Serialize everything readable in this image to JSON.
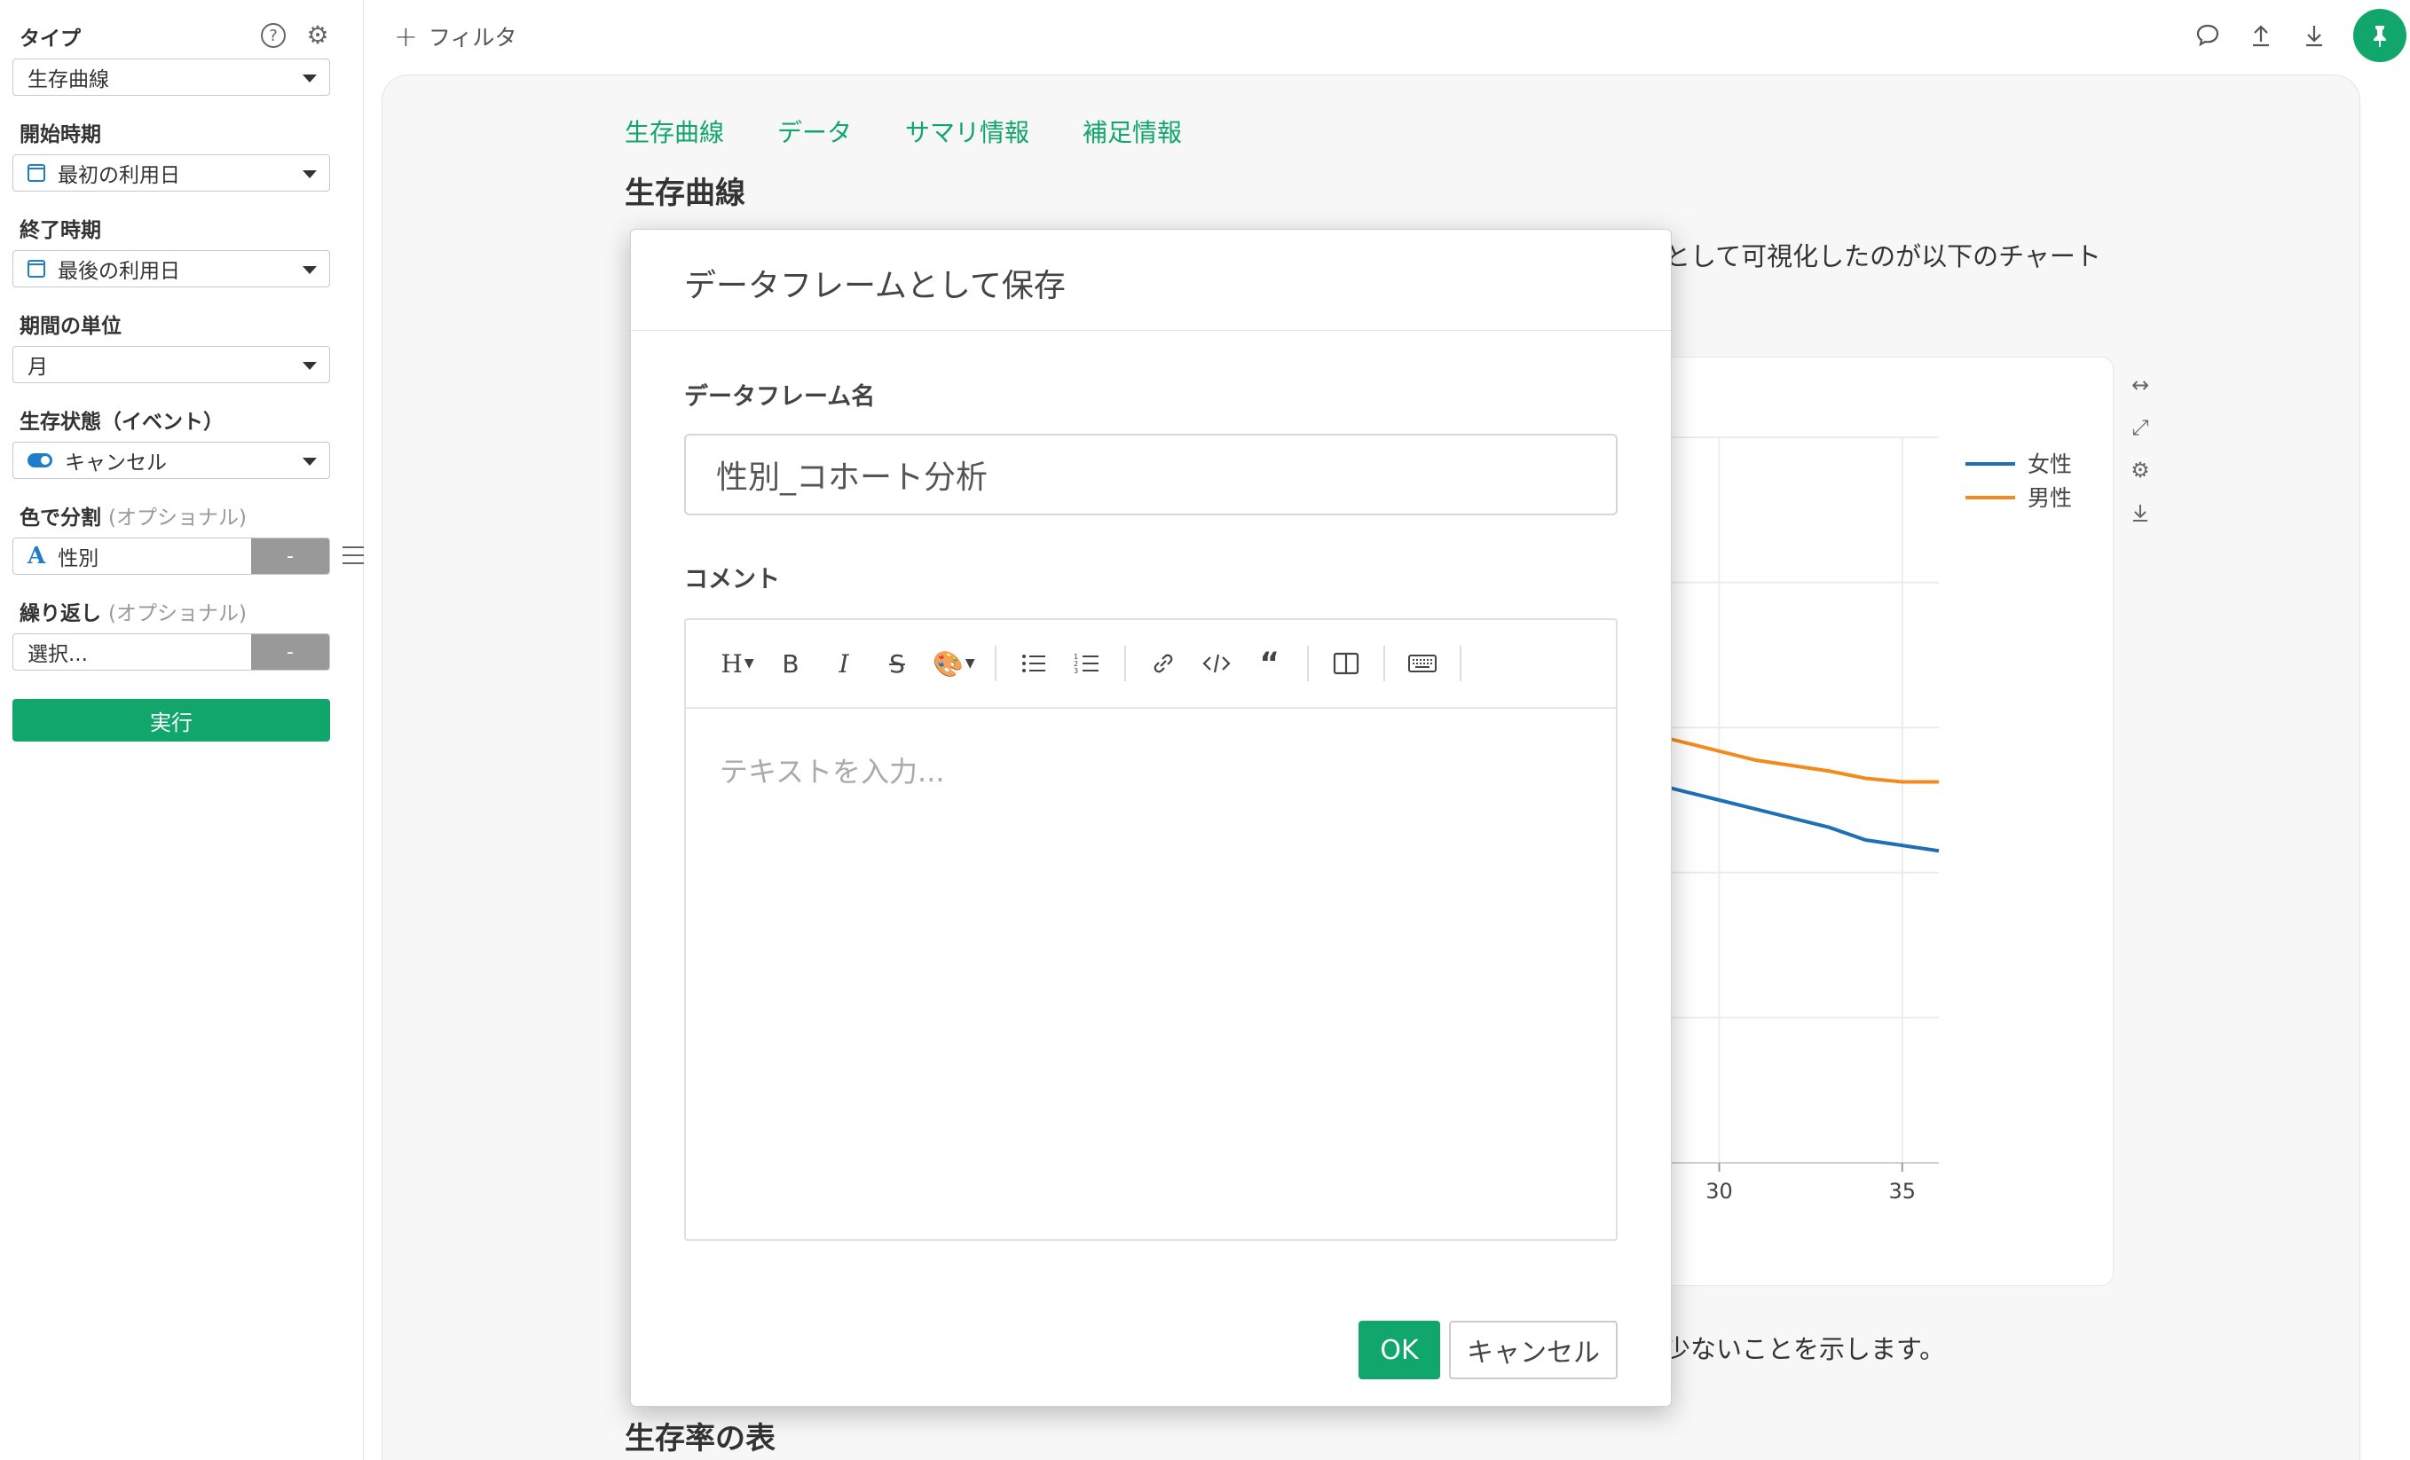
{
  "sidebar": {
    "type_label": "タイプ",
    "type_value": "生存曲線",
    "start_label": "開始時期",
    "start_value": "最初の利用日",
    "end_label": "終了時期",
    "end_value": "最後の利用日",
    "unit_label": "期間の単位",
    "unit_value": "月",
    "event_label": "生存状態（イベント）",
    "event_value": "キャンセル",
    "color_label": "色で分割",
    "color_optional": "(オプショナル)",
    "color_value": "性別",
    "color_btn": "-",
    "repeat_label": "繰り返し",
    "repeat_optional": "(オプショナル)",
    "repeat_value": "選択...",
    "repeat_btn": "-",
    "run_label": "実行"
  },
  "topbar": {
    "filter_label": "フィルタ"
  },
  "main": {
    "tabs": [
      {
        "label": "生存曲線"
      },
      {
        "label": "データ"
      },
      {
        "label": "サマリ情報"
      },
      {
        "label": "補足情報"
      }
    ],
    "section_title": "生存曲線",
    "para1_tail": "として可視化したのが以下のチャート",
    "para2_tail": "少ないことを示します。",
    "section2_title": "生存率の表"
  },
  "chart_data": {
    "type": "line",
    "x": [
      28,
      29,
      30,
      31,
      32,
      33,
      34,
      35,
      36
    ],
    "x_ticks": [
      30,
      35
    ],
    "series": [
      {
        "name": "女性",
        "color": "#1f6fb5",
        "values": [
          0.76,
          0.755,
          0.75,
          0.745,
          0.74,
          0.735,
          0.728,
          0.725,
          0.722
        ]
      },
      {
        "name": "男性",
        "color": "#f28a1e",
        "values": [
          0.787,
          0.782,
          0.777,
          0.772,
          0.769,
          0.766,
          0.762,
          0.76,
          0.76
        ]
      }
    ],
    "grid": true,
    "legend": "top-right"
  },
  "modal": {
    "title": "データフレームとして保存",
    "name_label": "データフレーム名",
    "name_value": "性別_コホート分析",
    "comment_label": "コメント",
    "comment_placeholder": "テキストを入力...",
    "ok_label": "OK",
    "cancel_label": "キャンセル"
  }
}
